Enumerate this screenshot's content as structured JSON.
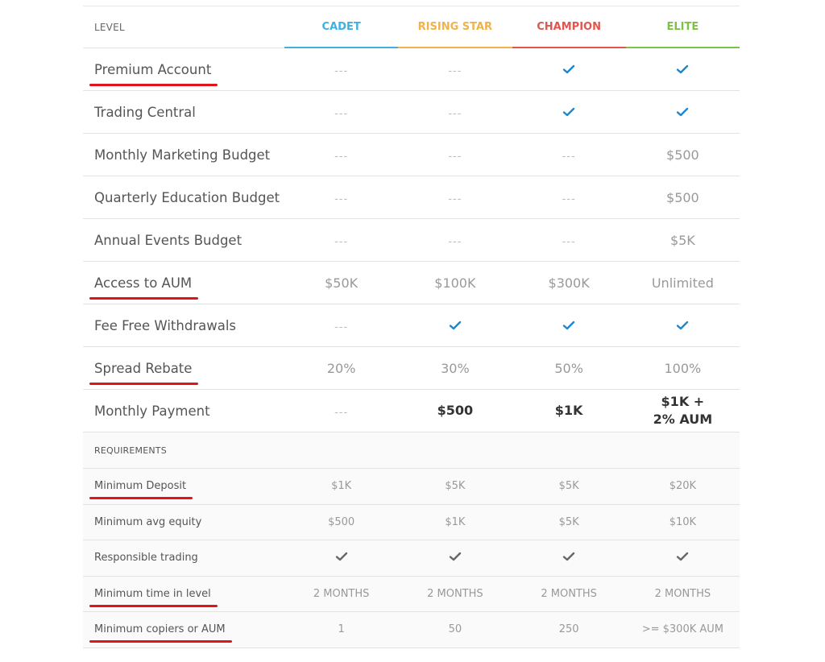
{
  "header": {
    "level_label": "LEVEL",
    "tiers": [
      {
        "name": "CADET",
        "color": "#3fb0e0"
      },
      {
        "name": "RISING STAR",
        "color": "#f0b24a"
      },
      {
        "name": "CHAMPION",
        "color": "#e0554e"
      },
      {
        "name": "ELITE",
        "color": "#7cc243"
      }
    ]
  },
  "colors": {
    "check_blue": "#1c86d0",
    "check_gray": "#666666",
    "underline_red": "#e1141b"
  },
  "benefits": [
    {
      "label": "Premium Account",
      "underlined": true,
      "values": [
        "---",
        "---",
        "check",
        "check"
      ]
    },
    {
      "label": "Trading Central",
      "underlined": false,
      "values": [
        "---",
        "---",
        "check",
        "check"
      ]
    },
    {
      "label": "Monthly Marketing Budget",
      "underlined": false,
      "values": [
        "---",
        "---",
        "---",
        "$500"
      ]
    },
    {
      "label": "Quarterly Education Budget",
      "underlined": false,
      "values": [
        "---",
        "---",
        "---",
        "$500"
      ]
    },
    {
      "label": "Annual Events Budget",
      "underlined": false,
      "values": [
        "---",
        "---",
        "---",
        "$5K"
      ]
    },
    {
      "label": "Access to AUM",
      "underlined": true,
      "values": [
        "$50K",
        "$100K",
        "$300K",
        "Unlimited"
      ]
    },
    {
      "label": "Fee Free Withdrawals",
      "underlined": false,
      "values": [
        "---",
        "check",
        "check",
        "check"
      ]
    },
    {
      "label": "Spread Rebate",
      "underlined": true,
      "values": [
        "20%",
        "30%",
        "50%",
        "100%"
      ]
    },
    {
      "label": "Monthly Payment",
      "underlined": false,
      "bold": true,
      "values": [
        "---",
        "$500",
        "$1K",
        "$1K + 2% AUM"
      ]
    }
  ],
  "requirements": {
    "title": "REQUIREMENTS",
    "rows": [
      {
        "label": "Minimum Deposit",
        "underlined": true,
        "values": [
          "$1K",
          "$5K",
          "$5K",
          "$20K"
        ]
      },
      {
        "label": "Minimum avg equity",
        "underlined": false,
        "values": [
          "$500",
          "$1K",
          "$5K",
          "$10K"
        ]
      },
      {
        "label": "Responsible trading",
        "underlined": false,
        "values": [
          "check",
          "check",
          "check",
          "check"
        ]
      },
      {
        "label": "Minimum time in level",
        "underlined": true,
        "values": [
          "2 MONTHS",
          "2 MONTHS",
          "2 MONTHS",
          "2 MONTHS"
        ]
      },
      {
        "label": "Minimum copiers or AUM",
        "underlined": true,
        "values": [
          "1",
          "50",
          "250",
          ">= $300K AUM"
        ]
      }
    ]
  }
}
